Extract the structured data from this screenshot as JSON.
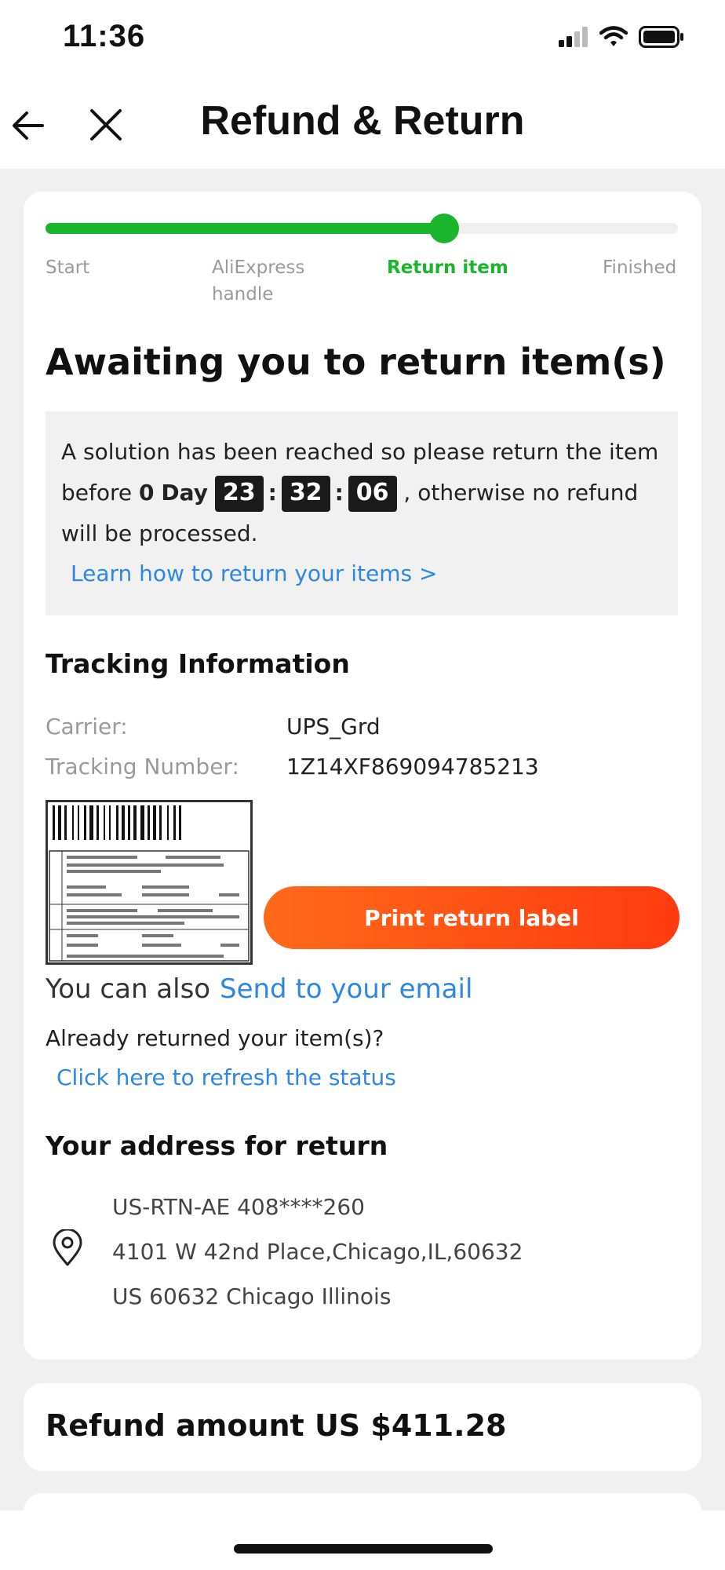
{
  "status_bar": {
    "time": "11:36"
  },
  "nav": {
    "title": "Refund & Return"
  },
  "progress": {
    "steps": [
      "Start",
      "AliExpress",
      "handle",
      "Return item",
      "Finished"
    ],
    "fraction": 0.63
  },
  "heading": "Awaiting you to return item(s)",
  "notice": {
    "line1": "A solution has been reached so please return the item",
    "before": "before",
    "days": "0",
    "day_word": "Day",
    "hours": "23",
    "minutes": "32",
    "seconds": "06",
    "after": ", otherwise no refund",
    "line3": "will be processed.",
    "link": "Learn how to return your items >"
  },
  "tracking": {
    "title": "Tracking Information",
    "carrier_label": "Carrier:",
    "carrier_value": "UPS_Grd",
    "number_label": "Tracking Number:",
    "number_value": "1Z14XF869094785213",
    "print_button": "Print return label"
  },
  "also": {
    "prefix": "You can also",
    "link": "Send to your email"
  },
  "already": {
    "question": "Already returned your item(s)?",
    "link": "Click here to refresh the status"
  },
  "address": {
    "title": "Your address for return",
    "line1": "US-RTN-AE 408****260",
    "line2": "4101 W 42nd Place,Chicago,IL,60632",
    "line3": "US 60632 Chicago Illinois"
  },
  "refund": {
    "amount_text": "Refund amount US $411.28"
  },
  "colors": {
    "accent_green": "#1ab52a",
    "link_blue": "#2d87e3",
    "button_orange": "#ff5514"
  }
}
